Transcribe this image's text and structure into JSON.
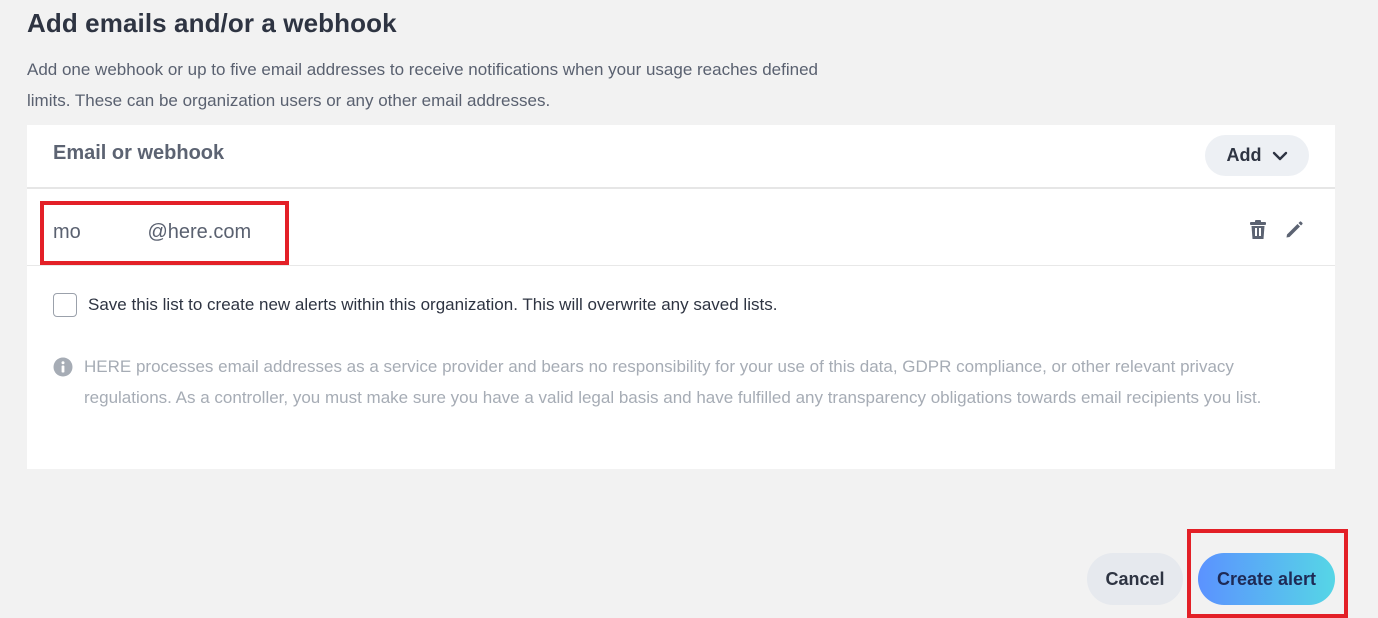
{
  "section": {
    "title": "Add emails and/or a webhook",
    "description": "Add one webhook or up to five email addresses to receive notifications when your usage reaches defined limits. These can be organization users or any other email addresses."
  },
  "table": {
    "header_label": "Email or webhook",
    "add_button_label": "Add",
    "add_button_icon": "chevron-down-icon",
    "rows": [
      {
        "value": "mo            @here.com",
        "actions": [
          "trash-icon",
          "pencil-icon"
        ]
      }
    ]
  },
  "save_list": {
    "checked": false,
    "label": "Save this list to create new alerts within this organization. This will overwrite any saved lists."
  },
  "disclaimer": {
    "icon": "info-icon",
    "text": "HERE processes email addresses as a service provider and bears no responsibility for your use of this data, GDPR compliance, or other relevant privacy regulations. As a controller, you must make sure you have a valid legal basis and have fulfilled any transparency obligations towards email recipients you list."
  },
  "footer": {
    "cancel_label": "Cancel",
    "create_label": "Create alert"
  },
  "colors": {
    "background": "#f2f2f2",
    "panel": "#ffffff",
    "highlight": "#e32027",
    "primary_gradient_start": "#5b92ff",
    "primary_gradient_end": "#56d6e6"
  }
}
